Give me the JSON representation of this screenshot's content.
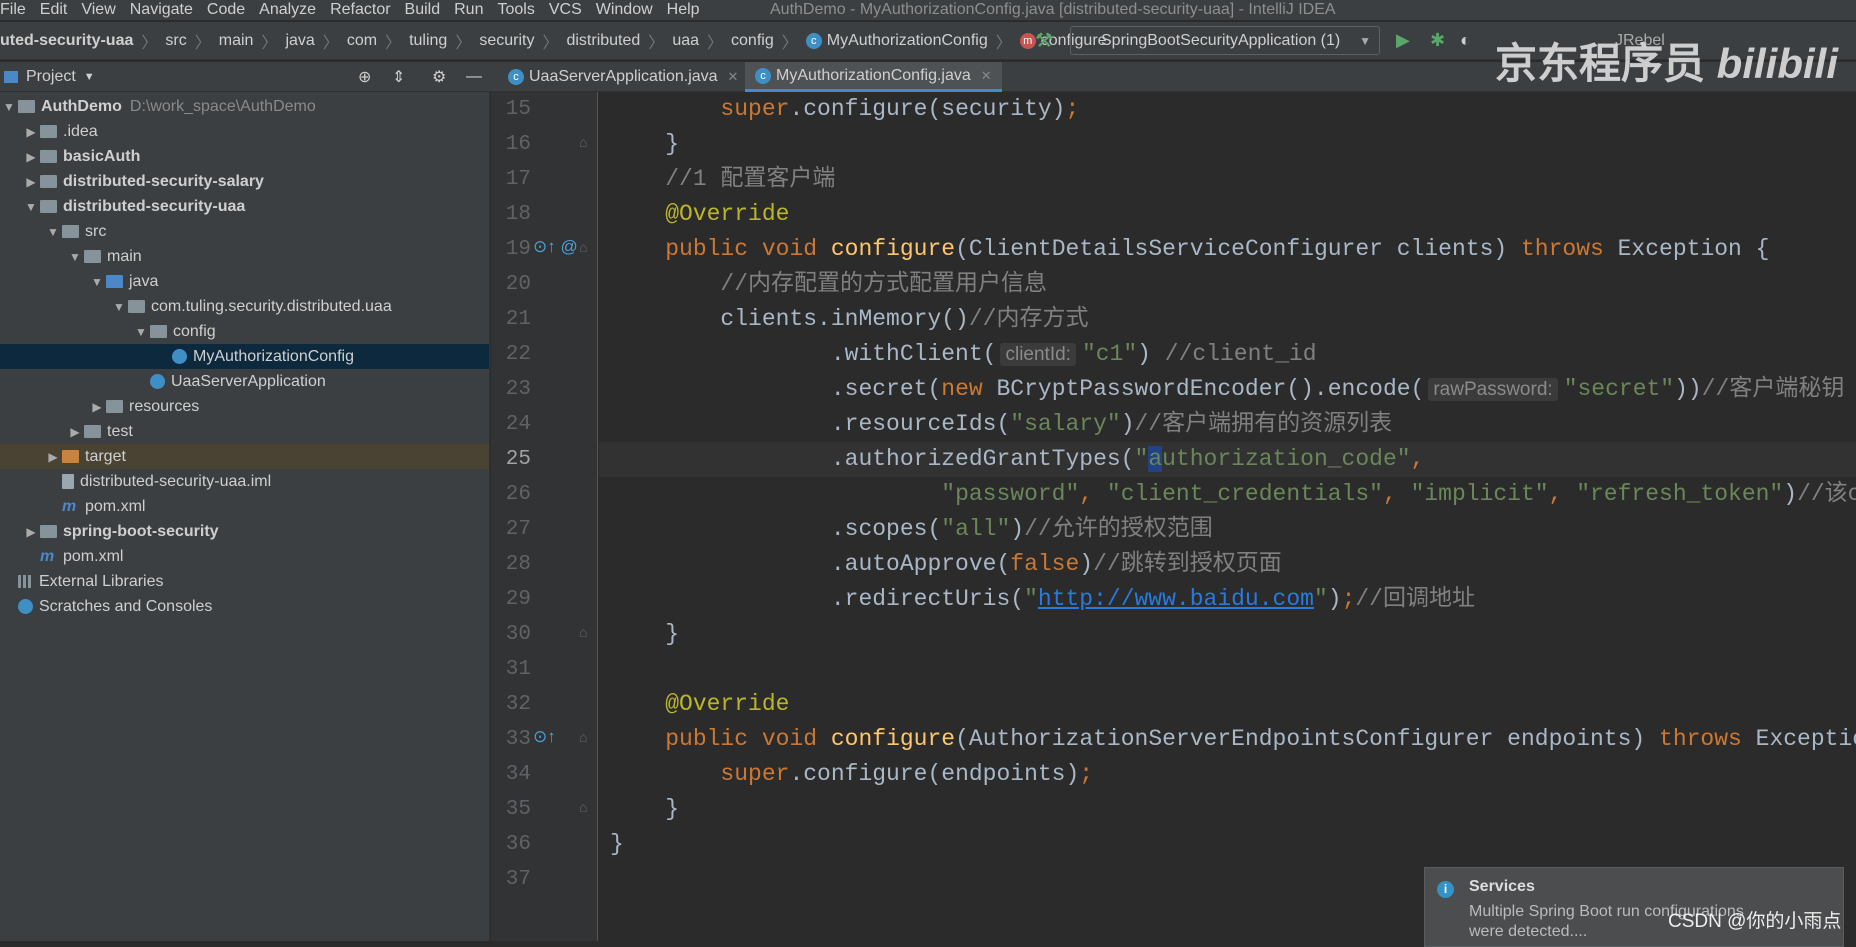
{
  "menu": {
    "items": [
      "File",
      "Edit",
      "View",
      "Navigate",
      "Code",
      "Analyze",
      "Refactor",
      "Build",
      "Run",
      "Tools",
      "VCS",
      "Window",
      "Help"
    ],
    "window_title": "AuthDemo - MyAuthorizationConfig.java [distributed-security-uaa] - IntelliJ IDEA"
  },
  "breadcrumb": [
    "uted-security-uaa",
    "src",
    "main",
    "java",
    "com",
    "tuling",
    "security",
    "distributed",
    "uaa",
    "config",
    "MyAuthorizationConfig",
    "configure"
  ],
  "run_config": "SpringBootSecurityApplication (1)",
  "jrebel": "JRebel",
  "project_panel": {
    "title": "Project"
  },
  "tabs": [
    {
      "label": "UaaServerApplication.java",
      "active": false
    },
    {
      "label": "MyAuthorizationConfig.java",
      "active": true
    }
  ],
  "tree": [
    {
      "label": "AuthDemo",
      "extra": "D:\\work_space\\AuthDemo",
      "level": 0,
      "arrow": "▼",
      "icon": "module",
      "bold": true
    },
    {
      "label": ".idea",
      "level": 1,
      "arrow": "▶",
      "icon": "folder"
    },
    {
      "label": "basicAuth",
      "level": 1,
      "arrow": "▶",
      "icon": "module",
      "bold": true
    },
    {
      "label": "distributed-security-salary",
      "level": 1,
      "arrow": "▶",
      "icon": "module",
      "bold": true
    },
    {
      "label": "distributed-security-uaa",
      "level": 1,
      "arrow": "▼",
      "icon": "module",
      "bold": true
    },
    {
      "label": "src",
      "level": 2,
      "arrow": "▼",
      "icon": "folder"
    },
    {
      "label": "main",
      "level": 3,
      "arrow": "▼",
      "icon": "folder"
    },
    {
      "label": "java",
      "level": 4,
      "arrow": "▼",
      "icon": "src"
    },
    {
      "label": "com.tuling.security.distributed.uaa",
      "level": 5,
      "arrow": "▼",
      "icon": "folder"
    },
    {
      "label": "config",
      "level": 6,
      "arrow": "▼",
      "icon": "folder"
    },
    {
      "label": "MyAuthorizationConfig",
      "level": 7,
      "arrow": "",
      "icon": "cls",
      "selected": true
    },
    {
      "label": "UaaServerApplication",
      "level": 6,
      "arrow": "",
      "icon": "cls"
    },
    {
      "label": "resources",
      "level": 4,
      "arrow": "▶",
      "icon": "folder"
    },
    {
      "label": "test",
      "level": 3,
      "arrow": "▶",
      "icon": "folder"
    },
    {
      "label": "target",
      "level": 2,
      "arrow": "▶",
      "icon": "orange",
      "excluded": true
    },
    {
      "label": "distributed-security-uaa.iml",
      "level": 2,
      "arrow": "",
      "icon": "file"
    },
    {
      "label": "pom.xml",
      "level": 2,
      "arrow": "",
      "icon": "maven"
    },
    {
      "label": "spring-boot-security",
      "level": 1,
      "arrow": "▶",
      "icon": "module",
      "bold": true
    },
    {
      "label": "pom.xml",
      "level": 1,
      "arrow": "",
      "icon": "maven"
    },
    {
      "label": "External Libraries",
      "level": 0,
      "arrow": "",
      "icon": "lib"
    },
    {
      "label": "Scratches and Consoles",
      "level": 0,
      "arrow": "",
      "icon": "scratch"
    }
  ],
  "code": {
    "current_line": 25,
    "lines": [
      {
        "n": 15,
        "t": [
          [
            "        "
          ],
          [
            "super",
            "k"
          ],
          [
            ".configure(security)"
          ],
          [
            ";",
            "k"
          ]
        ]
      },
      {
        "n": 16,
        "t": [
          [
            "    }"
          ]
        ]
      },
      {
        "n": 17,
        "t": [
          [
            "    //1 配置客户端",
            "c"
          ]
        ]
      },
      {
        "n": 18,
        "t": [
          [
            "    "
          ],
          [
            "@Override",
            "a"
          ]
        ]
      },
      {
        "n": 19,
        "t": [
          [
            "    "
          ],
          [
            "public void ",
            "k"
          ],
          [
            "configure",
            "f"
          ],
          [
            "(ClientDetailsServiceConfigurer clients) "
          ],
          [
            "throws ",
            "k"
          ],
          [
            "Exception {"
          ]
        ]
      },
      {
        "n": 20,
        "t": [
          [
            "        //内存配置的方式配置用户信息",
            "c"
          ]
        ]
      },
      {
        "n": 21,
        "t": [
          [
            "        clients.inMemory()"
          ],
          [
            "//内存方式",
            "c"
          ]
        ]
      },
      {
        "n": 22,
        "t": [
          [
            "                .withClient("
          ],
          [
            "clientId:",
            "ih"
          ],
          [
            "\"c1\"",
            "s"
          ],
          [
            ") "
          ],
          [
            "//client_id",
            "c"
          ]
        ]
      },
      {
        "n": 23,
        "t": [
          [
            "                .secret("
          ],
          [
            "new ",
            "k"
          ],
          [
            "BCryptPasswordEncoder().encode("
          ],
          [
            "rawPassword:",
            "ih"
          ],
          [
            "\"secret\"",
            "s"
          ],
          [
            "))"
          ],
          [
            "//客户端秘钥",
            "c"
          ]
        ]
      },
      {
        "n": 24,
        "t": [
          [
            "                .resourceIds("
          ],
          [
            "\"salary\"",
            "s"
          ],
          [
            ")"
          ],
          [
            "//客户端拥有的资源列表",
            "c"
          ]
        ]
      },
      {
        "n": 25,
        "t": [
          [
            "                .authorizedGrantTypes("
          ],
          [
            "\"",
            "s"
          ],
          [
            "a",
            "s sel-ch"
          ],
          [
            "uthorization_code\"",
            "s"
          ],
          [
            ",",
            "k"
          ]
        ]
      },
      {
        "n": 26,
        "t": [
          [
            "                        "
          ],
          [
            "\"password\"",
            "s"
          ],
          [
            ", ",
            "k"
          ],
          [
            "\"client_credentials\"",
            "s"
          ],
          [
            ", ",
            "k"
          ],
          [
            "\"implicit\"",
            "s"
          ],
          [
            ", ",
            "k"
          ],
          [
            "\"refresh_token\"",
            "s"
          ],
          [
            ")"
          ],
          [
            "//该client允许的授权类型",
            "c"
          ]
        ]
      },
      {
        "n": 27,
        "t": [
          [
            "                .scopes("
          ],
          [
            "\"all\"",
            "s"
          ],
          [
            ")"
          ],
          [
            "//允许的授权范围",
            "c"
          ]
        ]
      },
      {
        "n": 28,
        "t": [
          [
            "                .autoApprove("
          ],
          [
            "false",
            "k"
          ],
          [
            ")"
          ],
          [
            "//跳转到授权页面",
            "c"
          ]
        ]
      },
      {
        "n": 29,
        "t": [
          [
            "                .redirectUris("
          ],
          [
            "\"",
            "s"
          ],
          [
            "http://www.baidu.com",
            "u"
          ],
          [
            "\"",
            "s"
          ],
          [
            ")"
          ],
          [
            ";",
            "k"
          ],
          [
            "//回调地址",
            "c"
          ]
        ]
      },
      {
        "n": 30,
        "t": [
          [
            "    }"
          ]
        ]
      },
      {
        "n": 31,
        "t": [
          [
            ""
          ]
        ]
      },
      {
        "n": 32,
        "t": [
          [
            "    "
          ],
          [
            "@Override",
            "a"
          ]
        ]
      },
      {
        "n": 33,
        "t": [
          [
            "    "
          ],
          [
            "public void ",
            "k"
          ],
          [
            "configure",
            "f"
          ],
          [
            "(AuthorizationServerEndpointsConfigurer endpoints) "
          ],
          [
            "throws ",
            "k"
          ],
          [
            "Exception {"
          ]
        ]
      },
      {
        "n": 34,
        "t": [
          [
            "        "
          ],
          [
            "super",
            "k"
          ],
          [
            ".configure(endpoints)"
          ],
          [
            ";",
            "k"
          ]
        ]
      },
      {
        "n": 35,
        "t": [
          [
            "    }"
          ]
        ]
      },
      {
        "n": 36,
        "t": [
          [
            "}"
          ]
        ]
      },
      {
        "n": 37,
        "t": [
          [
            ""
          ]
        ]
      }
    ]
  },
  "notification": {
    "title": "Services",
    "body": "Multiple Spring Boot run configurations were detected...."
  },
  "watermarks": {
    "channel": "京东程序员 bilibili",
    "csdn": "CSDN @你的小雨点"
  },
  "colors": {
    "keyword": "#cc7832",
    "method": "#ffc66d",
    "string": "#6a8759",
    "comment": "#808080",
    "annotation": "#bbb529",
    "accent": "#4a88c7"
  }
}
